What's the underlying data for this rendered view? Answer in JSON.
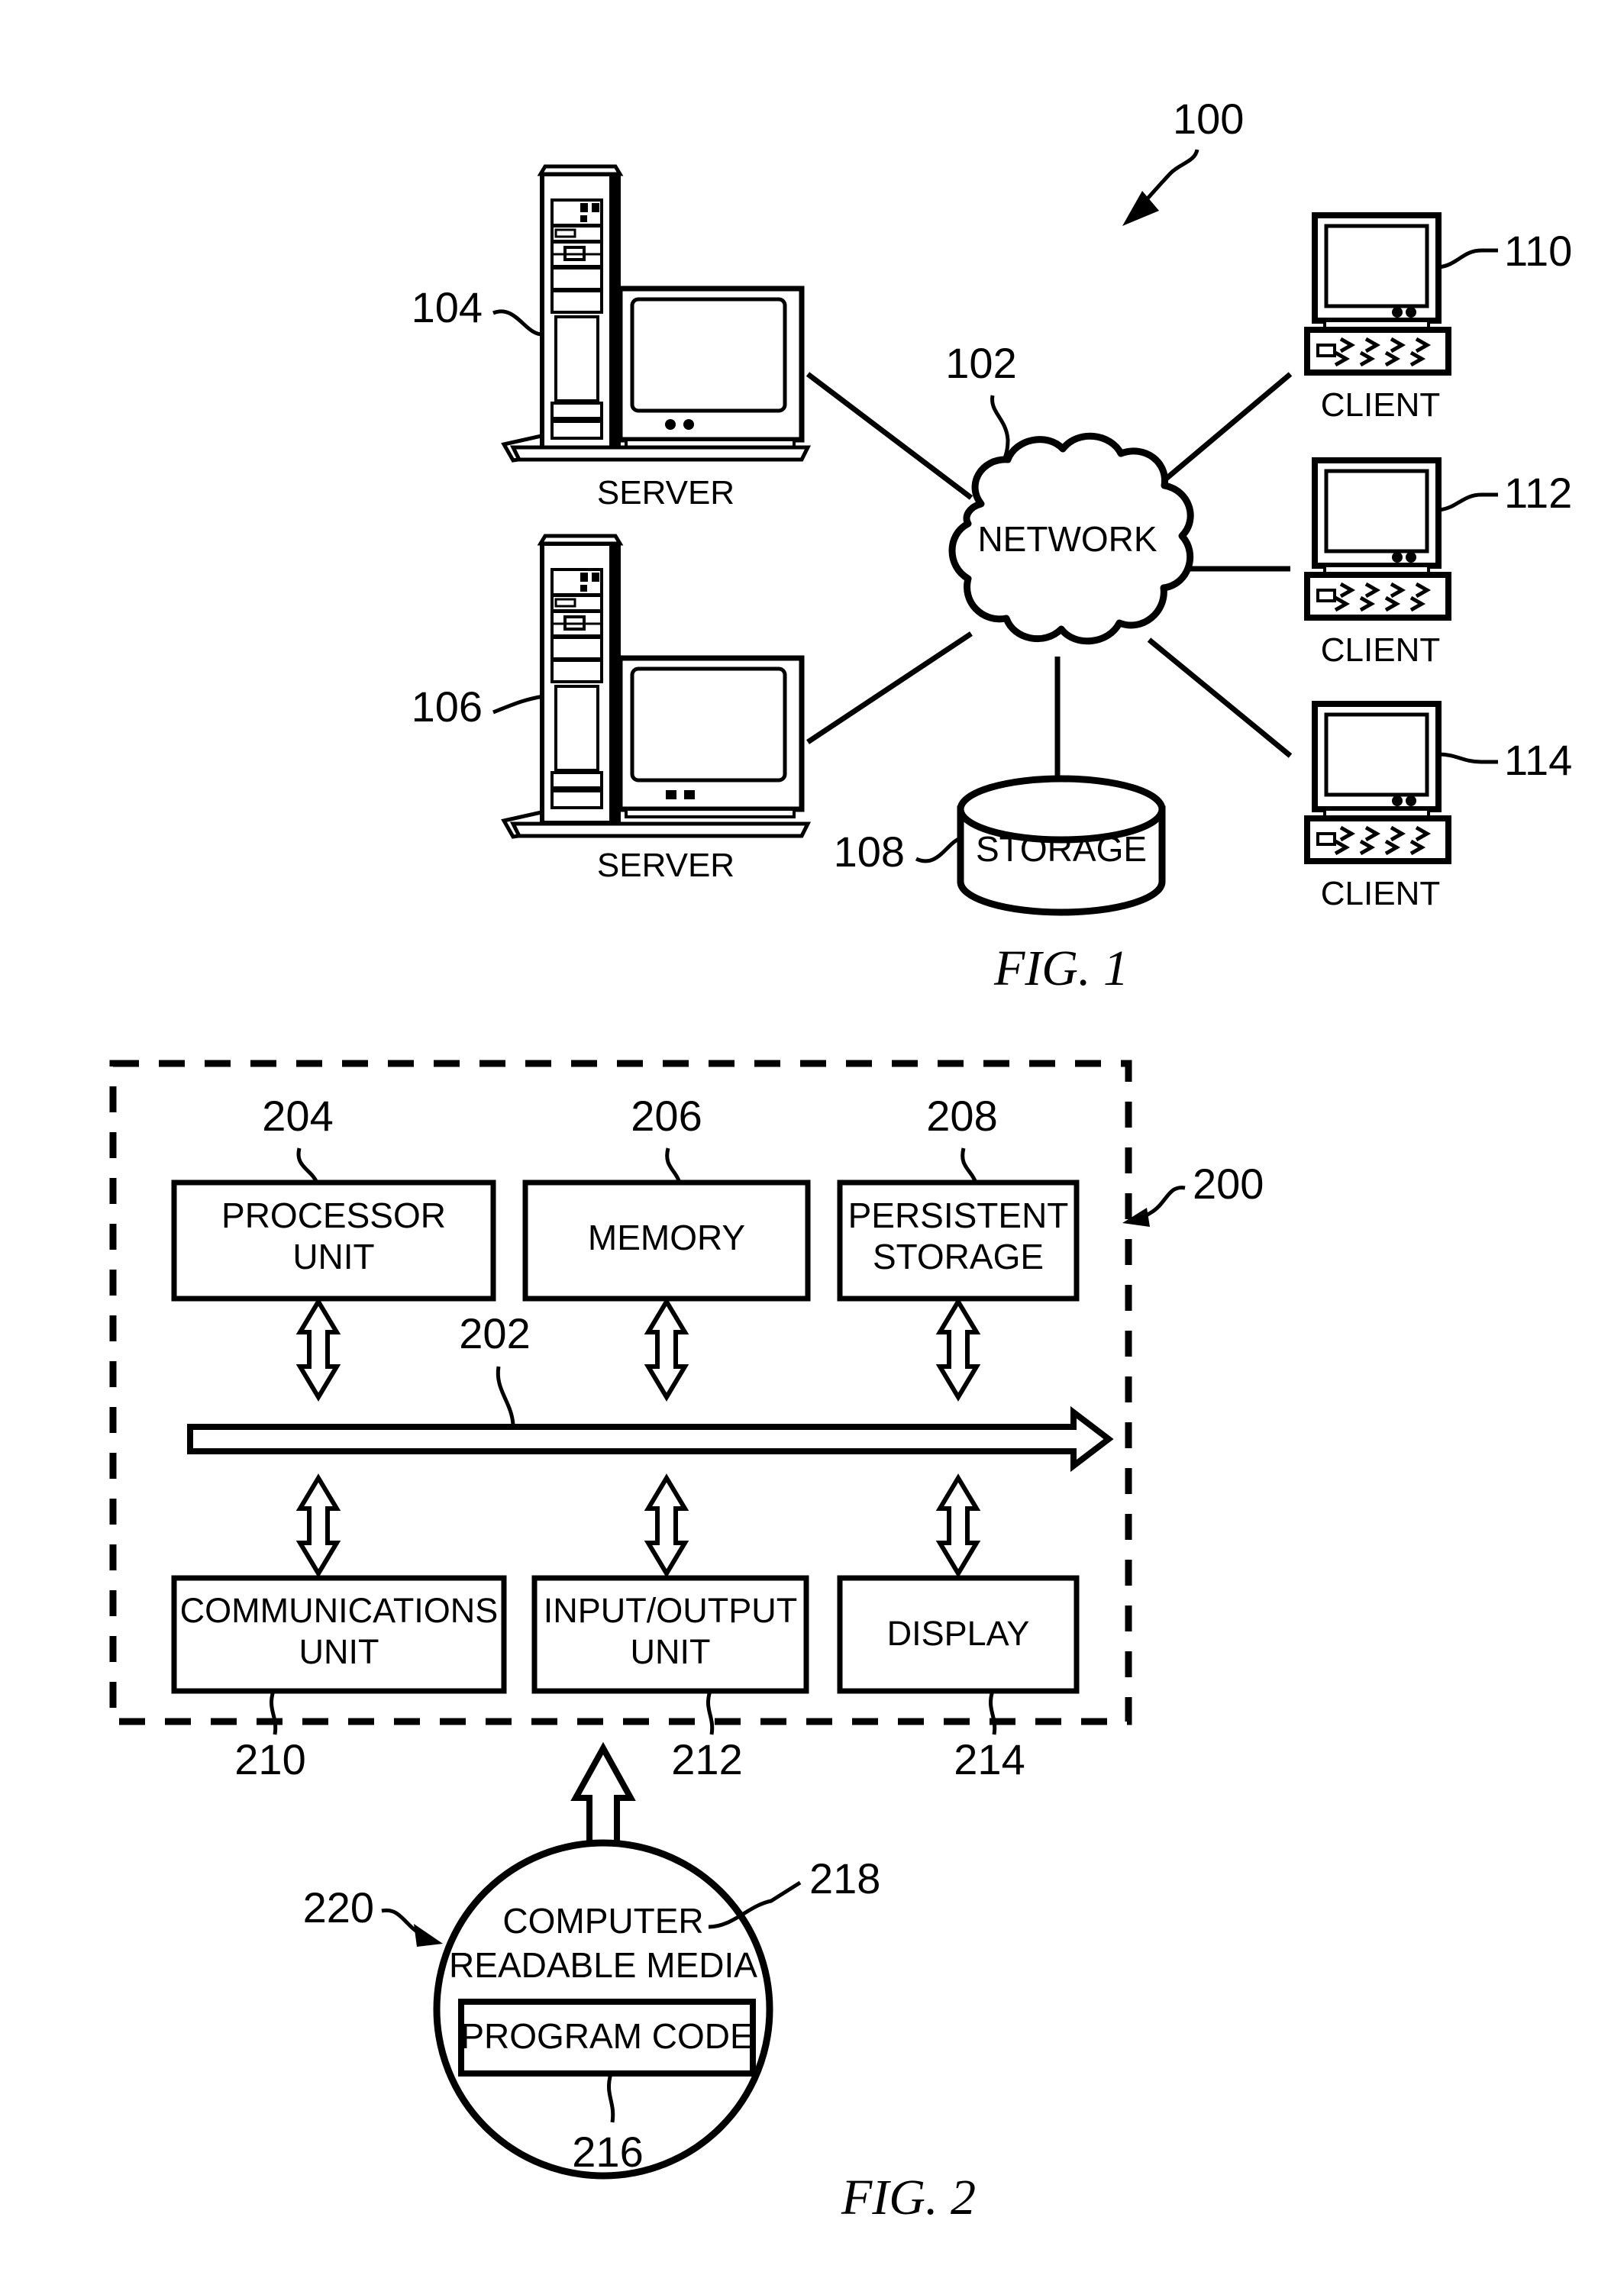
{
  "figures": [
    {
      "id": "fig1",
      "caption": "FIG. 1",
      "system_ref": "100",
      "nodes": {
        "network": {
          "label": "NETWORK",
          "ref": "102"
        },
        "server_top": {
          "label": "SERVER",
          "ref": "104"
        },
        "server_bottom": {
          "label": "SERVER",
          "ref": "106"
        },
        "storage": {
          "label": "STORAGE",
          "ref": "108"
        },
        "client_1": {
          "label": "CLIENT",
          "ref": "110"
        },
        "client_2": {
          "label": "CLIENT",
          "ref": "112"
        },
        "client_3": {
          "label": "CLIENT",
          "ref": "114"
        }
      }
    },
    {
      "id": "fig2",
      "caption": "FIG. 2",
      "system_ref": "200",
      "bus": {
        "ref": "202"
      },
      "top_blocks": [
        {
          "label_line1": "PROCESSOR",
          "label_line2": "UNIT",
          "ref": "204"
        },
        {
          "label_line1": "MEMORY",
          "label_line2": "",
          "ref": "206"
        },
        {
          "label_line1": "PERSISTENT",
          "label_line2": "STORAGE",
          "ref": "208"
        }
      ],
      "bottom_blocks": [
        {
          "label_line1": "COMMUNICATIONS",
          "label_line2": "UNIT",
          "ref": "210"
        },
        {
          "label_line1": "INPUT/OUTPUT",
          "label_line2": "UNIT",
          "ref": "212"
        },
        {
          "label_line1": "DISPLAY",
          "label_line2": "",
          "ref": "214"
        }
      ],
      "media": {
        "label_line1": "COMPUTER",
        "label_line2": "READABLE MEDIA",
        "ref": "218",
        "outer_ref": "220",
        "program_code": {
          "label": "PROGRAM CODE",
          "ref": "216"
        }
      }
    }
  ],
  "colors": {
    "ink": "#000000",
    "paper": "#ffffff"
  }
}
